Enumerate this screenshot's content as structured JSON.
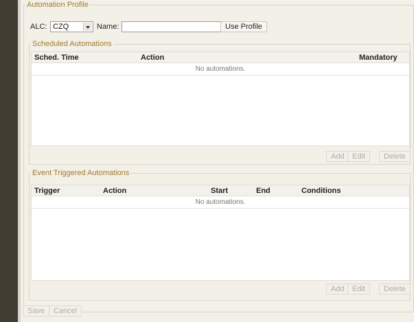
{
  "profile": {
    "legend": "Automation Profile",
    "alc_label": "ALC:",
    "alc_value": "CZQ",
    "name_label": "Name:",
    "name_value": "",
    "use_profile_label": "Use Profile"
  },
  "scheduled": {
    "legend": "Scheduled Automations",
    "columns": [
      "Sched. Time",
      "Action",
      "Mandatory"
    ],
    "empty_text": "No automations.",
    "buttons": {
      "add": "Add",
      "edit": "Edit",
      "delete": "Delete"
    }
  },
  "event": {
    "legend": "Event Triggered Automations",
    "columns": [
      "Trigger",
      "Action",
      "Start",
      "End",
      "Conditions"
    ],
    "empty_text": "No automations.",
    "buttons": {
      "add": "Add",
      "edit": "Edit",
      "delete": "Delete"
    }
  },
  "footer": {
    "save_label": "Save",
    "cancel_label": "Cancel"
  }
}
